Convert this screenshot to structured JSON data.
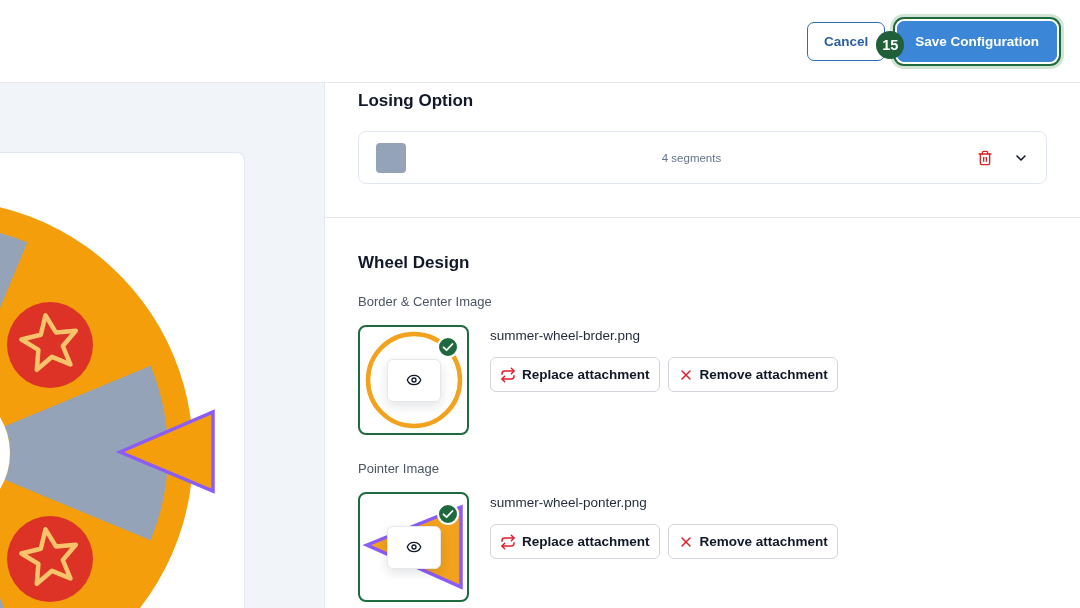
{
  "header": {
    "buttons": [
      {
        "label": "Cancel",
        "kind": "secondary",
        "focused": false
      },
      {
        "label": "Save Configuration",
        "kind": "primary",
        "focused": true,
        "badge": "15"
      }
    ]
  },
  "losing_option": {
    "title": "Losing Option",
    "color": "#94a3b8",
    "segments": "4 segments",
    "expanded": false
  },
  "wheel_design": {
    "title": "Wheel Design",
    "images": [
      {
        "label": "Border & Center Image",
        "kind": "border",
        "filename": "summer-wheel-brder.png",
        "uploaded": true,
        "buttons": [
          {
            "label": "Replace attachment",
            "kind": "replace"
          },
          {
            "label": "Remove attachment",
            "kind": "remove"
          }
        ]
      },
      {
        "label": "Pointer Image",
        "kind": "pointer",
        "filename": "summer-wheel-ponter.png",
        "uploaded": true,
        "buttons": [
          {
            "label": "Replace attachment",
            "kind": "replace"
          },
          {
            "label": "Remove attachment",
            "kind": "remove"
          }
        ]
      }
    ]
  }
}
